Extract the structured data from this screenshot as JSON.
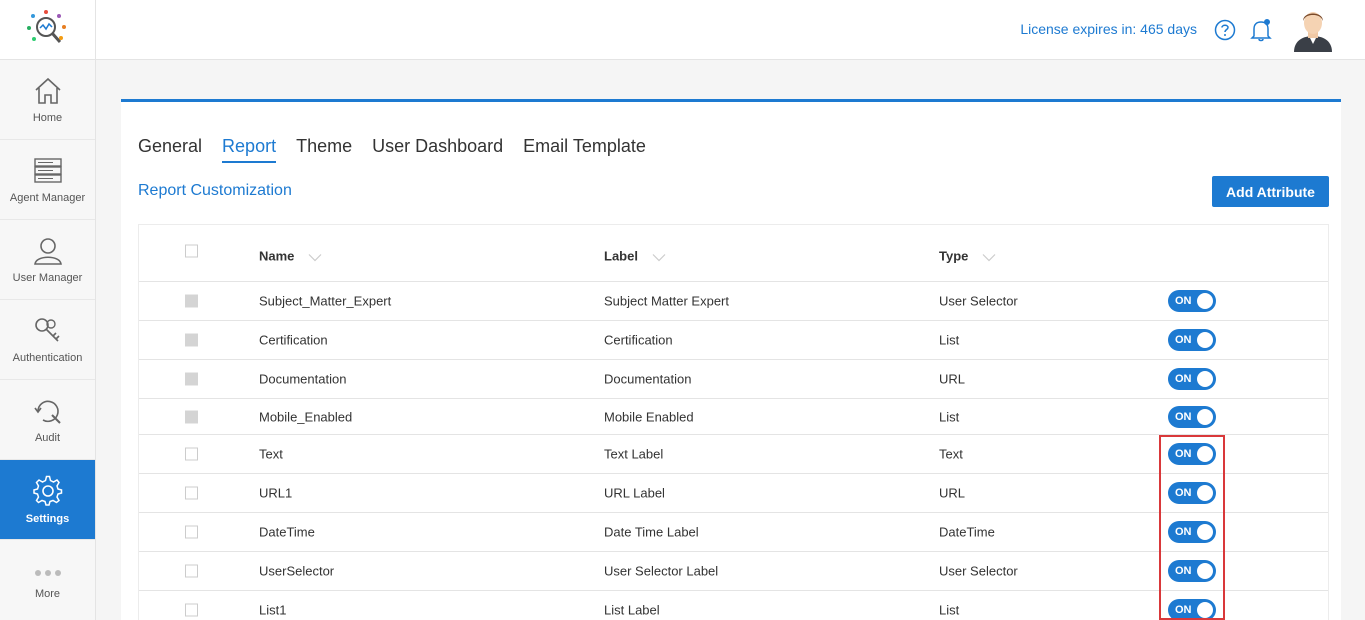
{
  "nav": {
    "items": [
      {
        "label": "Home",
        "icon": "home-icon"
      },
      {
        "label": "Agent Manager",
        "icon": "agent-manager-icon"
      },
      {
        "label": "User Manager",
        "icon": "user-icon"
      },
      {
        "label": "Authentication",
        "icon": "keys-icon"
      },
      {
        "label": "Audit",
        "icon": "audit-icon"
      },
      {
        "label": "Settings",
        "icon": "gear-icon"
      },
      {
        "label": "More",
        "icon": "more-icon"
      }
    ]
  },
  "header": {
    "license": "License expires in: 465 days"
  },
  "tabs": [
    "General",
    "Report",
    "Theme",
    "User Dashboard",
    "Email Template"
  ],
  "active_tab": "Report",
  "section": {
    "title": "Report Customization",
    "add_button": "Add Attribute"
  },
  "table": {
    "headers": {
      "name": "Name",
      "label": "Label",
      "type": "Type"
    },
    "rows": [
      {
        "name": "Subject_Matter_Expert",
        "label": "Subject Matter Expert",
        "type": "User Selector",
        "toggle": "ON",
        "checkbox_disabled": true
      },
      {
        "name": "Certification",
        "label": "Certification",
        "type": "List",
        "toggle": "ON",
        "checkbox_disabled": true
      },
      {
        "name": "Documentation",
        "label": "Documentation",
        "type": "URL",
        "toggle": "ON",
        "checkbox_disabled": true
      },
      {
        "name": "Mobile_Enabled",
        "label": "Mobile Enabled",
        "type": "List",
        "toggle": "ON",
        "checkbox_disabled": true
      },
      {
        "name": "Text",
        "label": "Text Label",
        "type": "Text",
        "toggle": "ON",
        "checkbox_disabled": false
      },
      {
        "name": "URL1",
        "label": "URL Label",
        "type": "URL",
        "toggle": "ON",
        "checkbox_disabled": false
      },
      {
        "name": "DateTime",
        "label": "Date Time Label",
        "type": "DateTime",
        "toggle": "ON",
        "checkbox_disabled": false
      },
      {
        "name": "UserSelector",
        "label": "User Selector Label",
        "type": "User Selector",
        "toggle": "ON",
        "checkbox_disabled": false
      },
      {
        "name": "List1",
        "label": "List Label",
        "type": "List",
        "toggle": "ON",
        "checkbox_disabled": false
      }
    ]
  },
  "colors": {
    "accent": "#1d7ad1",
    "highlight": "#d9383a"
  }
}
